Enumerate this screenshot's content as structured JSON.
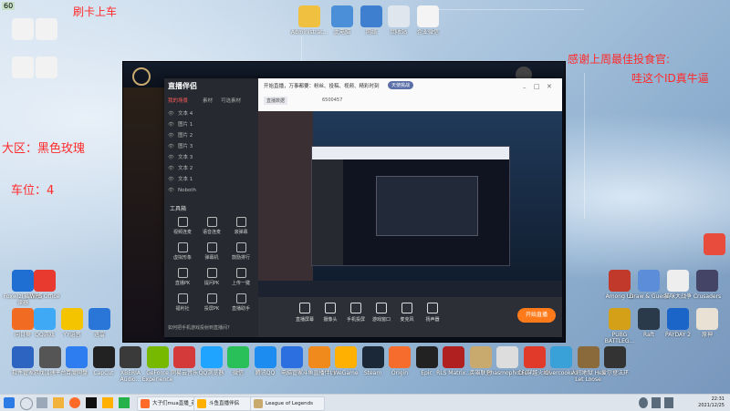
{
  "overlay": {
    "top_left_badge": "60",
    "top_title": "刷卡上车",
    "region": "大区：黑色玫瑰",
    "rank": "车位：4",
    "thanks_line1": "感谢上周最佳投食官:",
    "thanks_line2": "哇这个ID真牛逼"
  },
  "desktop_icons_top": [
    "Administrat...",
    "此电脑",
    "网络",
    "回收站",
    "企业微信"
  ],
  "desktop_icons_row1": [
    "Foxwiz(福昕)阅读器",
    "WPS Office",
    "Among Us",
    "Draw & Guess",
    "猫咪大战争",
    "Crusaders"
  ],
  "desktop_icons_row2": [
    "向日葵",
    "QQ游戏",
    "YY语音",
    "迅雷",
    "PUBG BATTLEG...",
    "Raft",
    "PAYDAY 2",
    "原神"
  ],
  "desktop_icons_bottom": [
    "软件管家",
    "游戏加速平台",
    "百度网盘",
    "CapCut",
    "XBERIA Audio...",
    "GeForce Experience",
    "网易云音乐",
    "QQ浏览器",
    "微信",
    "腾讯QQ",
    "电脑管家",
    "斗鱼直播伴侣",
    "WeGame",
    "Steam",
    "Origin",
    "Epic",
    "RLS Matrix...",
    "英雄联盟",
    "Phasmophobia",
    "CF(穿越火线)",
    "Overcooked",
    "人间地狱 Hell Let Loose",
    "爱尔登法环"
  ],
  "app": {
    "title": "直播伴侣",
    "tabs": [
      "我的场景",
      "素材",
      "可选素材"
    ],
    "scene_items": [
      "文本 4",
      "图片 1",
      "图片 2",
      "图片 3",
      "文本 3",
      "文本 2",
      "文本 1",
      "Noboth"
    ],
    "toolbar_label": "工具箱",
    "tools": [
      "视频连麦",
      "语音连麦",
      "滚弹幕",
      "虚拟形象",
      "弹幕机",
      "鼓励排行",
      "直播PK",
      "提问PK",
      "上传一键",
      "福利社",
      "投屏PK",
      "直播助手"
    ],
    "notice": "如何把手机游戏投射到直播间?",
    "top_text": "开始直播，万事都要：粉丝、投稿、视频、精彩时刻",
    "top_chip": "天使挑战",
    "room_label": "直播数据",
    "room_id": "6500457",
    "bottom_buttons": [
      "直播屏幕",
      "摄像头",
      "手机投屏",
      "游戏窗口",
      "麦克风",
      "扬声器"
    ],
    "start_button": "开始直播"
  },
  "taskbar": {
    "windows": [
      "大子们mua直播_英...",
      "斗鱼直播伴侣",
      "League of Legends"
    ],
    "clock_time": "22:31",
    "clock_date": "2021/12/25"
  }
}
